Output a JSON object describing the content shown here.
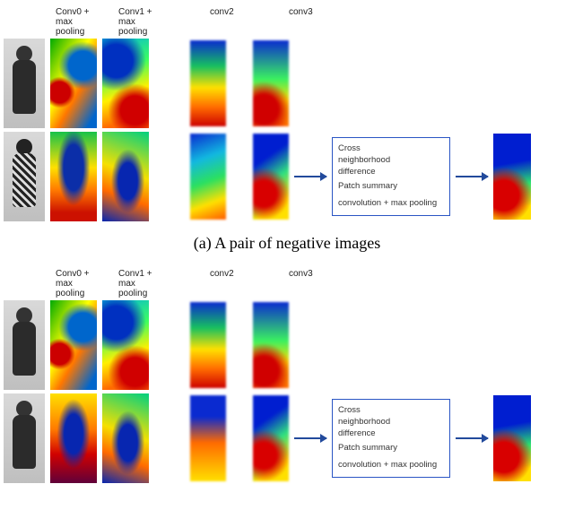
{
  "layer_labels": {
    "conv0": "Conv0 +\nmax\npooling",
    "conv1": "Conv1 +\nmax\npooling",
    "conv2": "conv2",
    "conv3": "conv3"
  },
  "ops_box": {
    "line1": "Cross",
    "line2": "neighborhood",
    "line3": "difference",
    "line4": "Patch summary",
    "line5": "convolution + max pooling"
  },
  "caption_a": "(a) A pair of negative images"
}
